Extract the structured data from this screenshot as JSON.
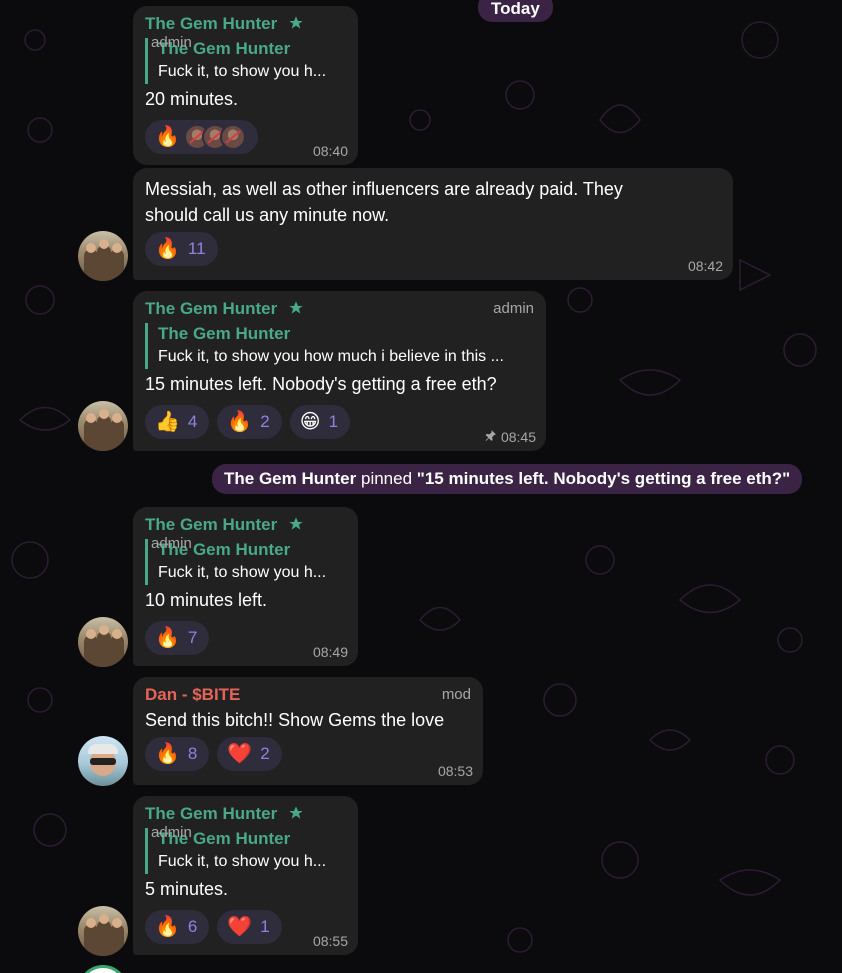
{
  "date_separator": "Today",
  "pinned_notice": {
    "actor": "The Gem Hunter",
    "action": "pinned",
    "message": "\"15 minutes left. Nobody's getting a free eth?\""
  },
  "messages": [
    {
      "sender": "The Gem Hunter",
      "role": "admin",
      "reply_to": {
        "name": "The Gem Hunter",
        "text": "Fuck it, to show you h..."
      },
      "text": "20 minutes.",
      "reactions": [
        {
          "emoji": "🔥",
          "icon": "fire-icon"
        }
      ],
      "time": "08:40"
    },
    {
      "text_lines": [
        "Messiah, as well as other influencers are already paid. They",
        "should call us any minute now."
      ],
      "reactions": [
        {
          "emoji": "🔥",
          "icon": "fire-icon",
          "count": "11"
        }
      ],
      "time": "08:42"
    },
    {
      "sender": "The Gem Hunter",
      "role": "admin",
      "reply_to": {
        "name": "The Gem Hunter",
        "text": "Fuck it, to show you how much i believe in this ..."
      },
      "text": "15 minutes left. Nobody's getting a free eth?",
      "reactions": [
        {
          "emoji": "👍",
          "icon": "thumbs-up-icon",
          "count": "4"
        },
        {
          "emoji": "🔥",
          "icon": "fire-icon",
          "count": "2"
        },
        {
          "emoji": "😁",
          "icon": "grin-icon",
          "count": "1"
        }
      ],
      "time": "08:45"
    },
    {
      "sender": "The Gem Hunter",
      "role": "admin",
      "reply_to": {
        "name": "The Gem Hunter",
        "text": "Fuck it, to show you h..."
      },
      "text": "10 minutes left.",
      "reactions": [
        {
          "emoji": "🔥",
          "icon": "fire-icon",
          "count": "7"
        }
      ],
      "time": "08:49"
    },
    {
      "sender": "Dan - $BITE",
      "role": "mod",
      "text": "Send this bitch!! Show Gems the love",
      "reactions": [
        {
          "emoji": "🔥",
          "icon": "fire-icon",
          "count": "8"
        },
        {
          "emoji": "❤️",
          "icon": "heart-icon",
          "count": "2"
        }
      ],
      "time": "08:53"
    },
    {
      "sender": "The Gem Hunter",
      "role": "admin",
      "reply_to": {
        "name": "The Gem Hunter",
        "text": "Fuck it, to show you h..."
      },
      "text": "5 minutes.",
      "reactions": [
        {
          "emoji": "🔥",
          "icon": "fire-icon",
          "count": "6"
        },
        {
          "emoji": "❤️",
          "icon": "heart-icon",
          "count": "1"
        }
      ],
      "time": "08:55"
    }
  ],
  "colors": {
    "background": "#0b0a0d",
    "bubble": "#212121",
    "service_pill": "#3a2344",
    "admin_name": "#4aa88a",
    "mod_name": "#e5645a",
    "reaction_chip": "#2f2c3c",
    "reaction_count": "#8e84e0",
    "meta_text": "#a7a7a7"
  }
}
